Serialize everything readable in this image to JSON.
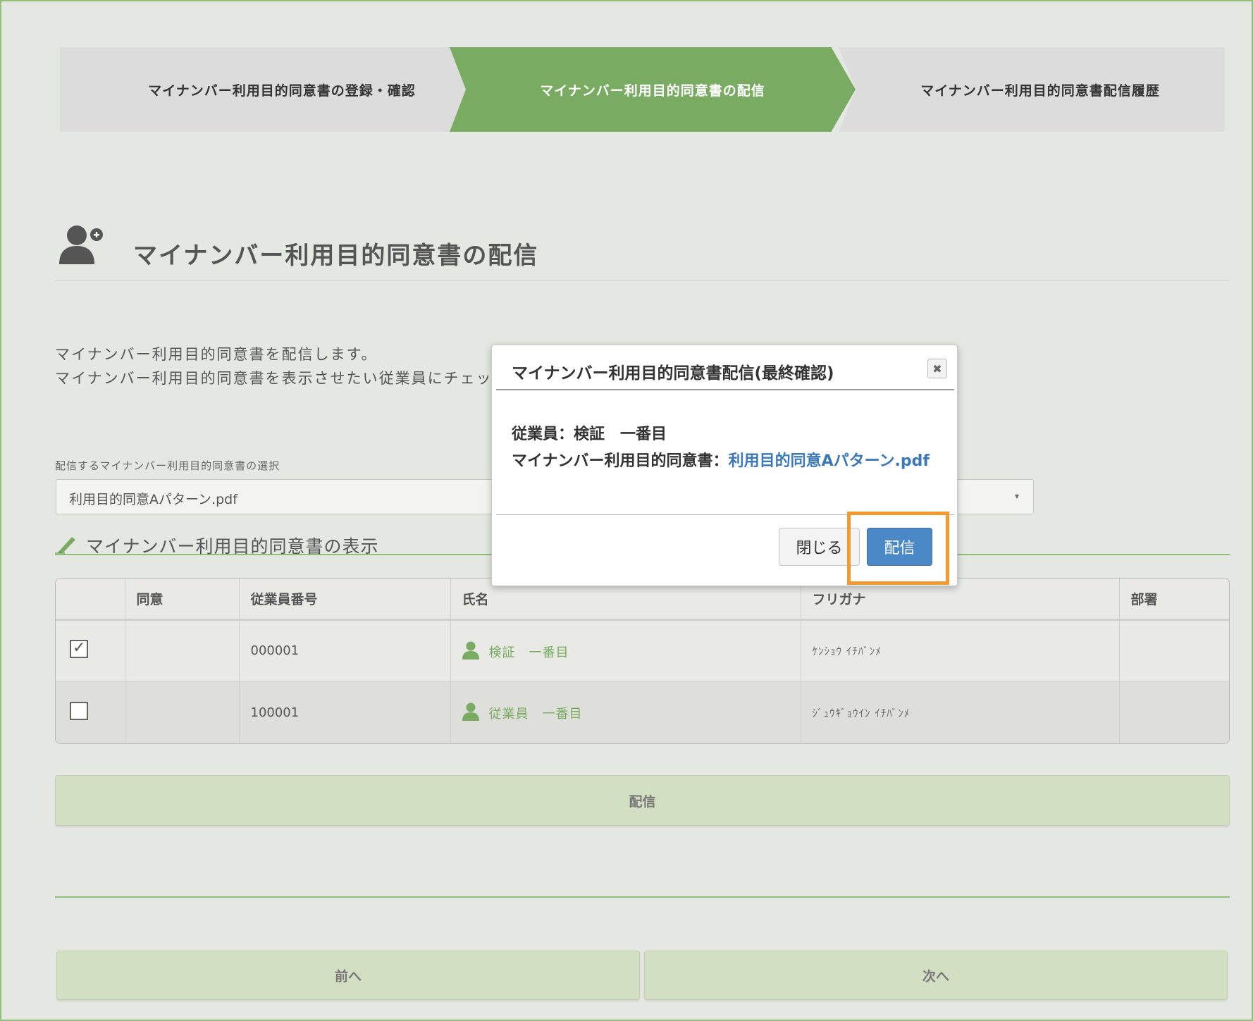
{
  "stepper": {
    "steps": [
      "マイナンバー利用目的同意書の登録・確認",
      "マイナンバー利用目的同意書の配信",
      "マイナンバー利用目的同意書配信履歴"
    ],
    "active_index": 1
  },
  "page": {
    "title": "マイナンバー利用目的同意書の配信",
    "description_line1": "マイナンバー利用目的同意書を配信します。",
    "description_line2": "マイナンバー利用目的同意書を表示させたい従業員にチェッ"
  },
  "select": {
    "label": "配信するマイナンバー利用目的同意書の選択",
    "value": "利用目的同意Aパターン.pdf"
  },
  "section": {
    "title": "マイナンバー利用目的同意書の表示"
  },
  "table": {
    "headers": [
      "",
      "同意",
      "従業員番号",
      "氏名",
      "フリガナ",
      "部署"
    ],
    "rows": [
      {
        "checked": true,
        "consent": "",
        "employee_no": "000001",
        "name": "検証　一番目",
        "furigana": "ｹﾝｼｮｳ ｲﾁﾊﾞﾝﾒ",
        "department": ""
      },
      {
        "checked": false,
        "consent": "",
        "employee_no": "100001",
        "name": "従業員　一番目",
        "furigana": "ｼﾞｭｳｷﾞｮｳｲﾝ ｲﾁﾊﾞﾝﾒ",
        "department": ""
      }
    ]
  },
  "buttons": {
    "send": "配信",
    "prev": "前へ",
    "next": "次へ"
  },
  "modal": {
    "title": "マイナンバー利用目的同意書配信(最終確認)",
    "employee_label": "従業員：検証　一番目",
    "document_label": "マイナンバー利用目的同意書：",
    "document_link": "利用目的同意Aパターン.pdf",
    "close_label": "閉じる",
    "deliver_label": "配信"
  },
  "colors": {
    "accent_green": "#7aab62",
    "highlight_orange": "#f29a30",
    "primary_blue": "#4a88c7"
  }
}
